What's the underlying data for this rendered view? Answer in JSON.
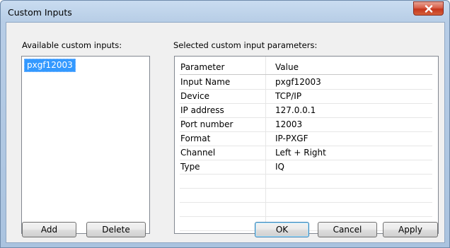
{
  "window": {
    "title": "Custom Inputs"
  },
  "left_panel": {
    "label": "Available custom inputs:",
    "items": [
      "pxgf12003"
    ]
  },
  "right_panel": {
    "label": "Selected custom input parameters:",
    "columns": [
      "Parameter",
      "Value"
    ],
    "rows": [
      [
        "Input Name",
        "pxgf12003"
      ],
      [
        "Device",
        "TCP/IP"
      ],
      [
        "IP address",
        "127.0.0.1"
      ],
      [
        "Port number",
        "12003"
      ],
      [
        "Format",
        "IP-PXGF"
      ],
      [
        "Channel",
        "Left + Right"
      ],
      [
        "Type",
        "IQ"
      ]
    ]
  },
  "buttons": {
    "add": "Add",
    "delete": "Delete",
    "ok": "OK",
    "cancel": "Cancel",
    "apply": "Apply"
  },
  "colors": {
    "selection": "#3399ff",
    "close_button": "#c6361d"
  },
  "icons": {
    "close": "close-icon"
  }
}
